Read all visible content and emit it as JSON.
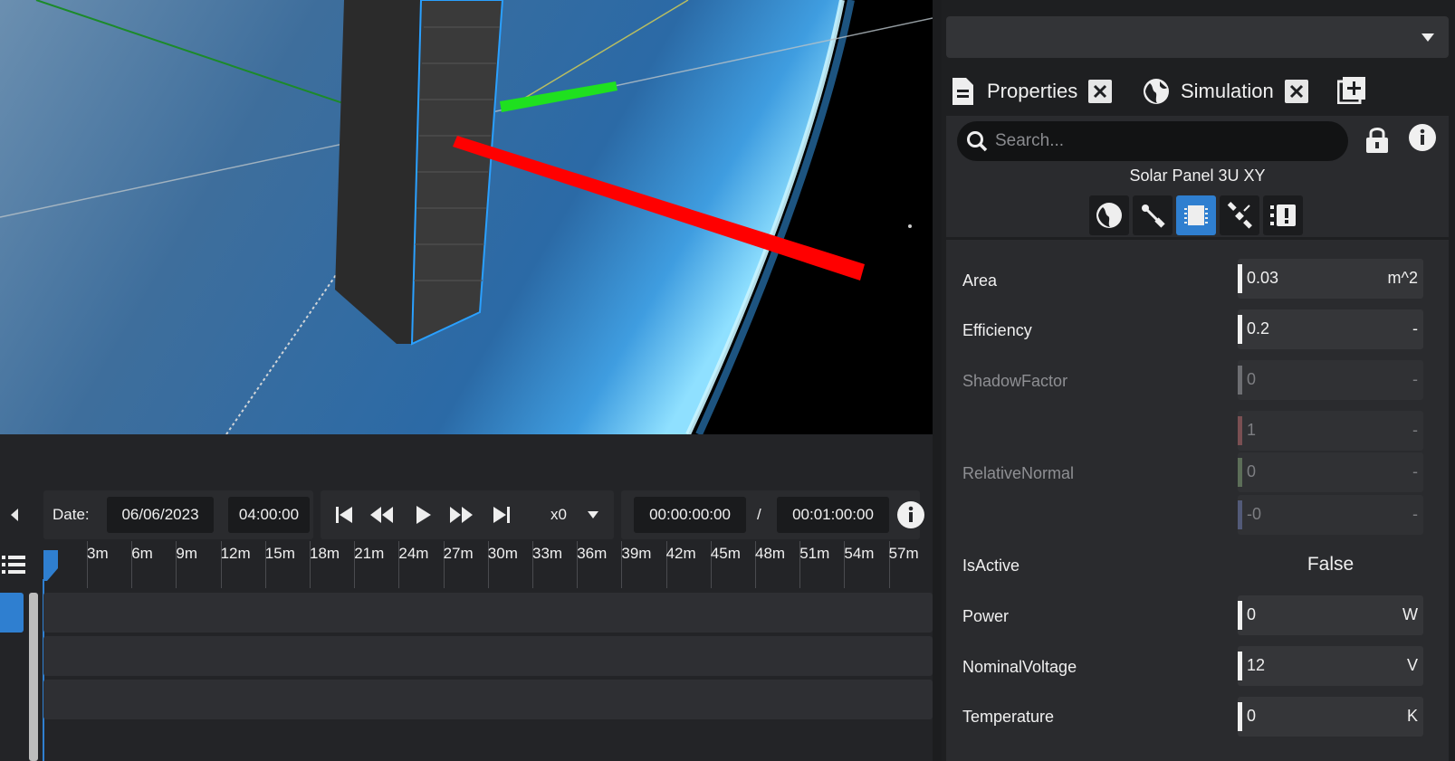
{
  "timeline": {
    "date_label": "Date:",
    "date_value": "06/06/2023",
    "time_value": "04:00:00",
    "speed": "x0",
    "current_time": "00:00:00:00",
    "separator": "/",
    "total_time": "00:01:00:00",
    "ticks": [
      "3m",
      "6m",
      "9m",
      "12m",
      "15m",
      "18m",
      "21m",
      "24m",
      "27m",
      "30m",
      "33m",
      "36m",
      "39m",
      "42m",
      "45m",
      "48m",
      "51m",
      "54m",
      "57m"
    ]
  },
  "panel": {
    "tabs": [
      {
        "label": "Properties",
        "icon": "document-icon"
      },
      {
        "label": "Simulation",
        "icon": "globe-icon"
      }
    ],
    "search_placeholder": "Search...",
    "selected_title": "Solar Panel 3U XY",
    "properties": [
      {
        "name": "Area",
        "value": "0.03",
        "unit": "m^2",
        "enabled": true
      },
      {
        "name": "Efficiency",
        "value": "0.2",
        "unit": "-",
        "enabled": true
      },
      {
        "name": "ShadowFactor",
        "value": "0",
        "unit": "-",
        "enabled": false
      },
      {
        "name": "RelativeNormal",
        "values": [
          "1",
          "0",
          "-0"
        ],
        "unit": "-",
        "enabled": false
      },
      {
        "name": "IsActive",
        "value": "False"
      },
      {
        "name": "Power",
        "value": "0",
        "unit": "W",
        "enabled": true
      },
      {
        "name": "NominalVoltage",
        "value": "12",
        "unit": "V",
        "enabled": true
      },
      {
        "name": "Temperature",
        "value": "0",
        "unit": "K",
        "enabled": true
      }
    ]
  },
  "colors": {
    "accent": "#2f7fd0",
    "panel_bg": "#2a2b2e",
    "x_axis": "#ff0000",
    "y_axis": "#00e000"
  }
}
